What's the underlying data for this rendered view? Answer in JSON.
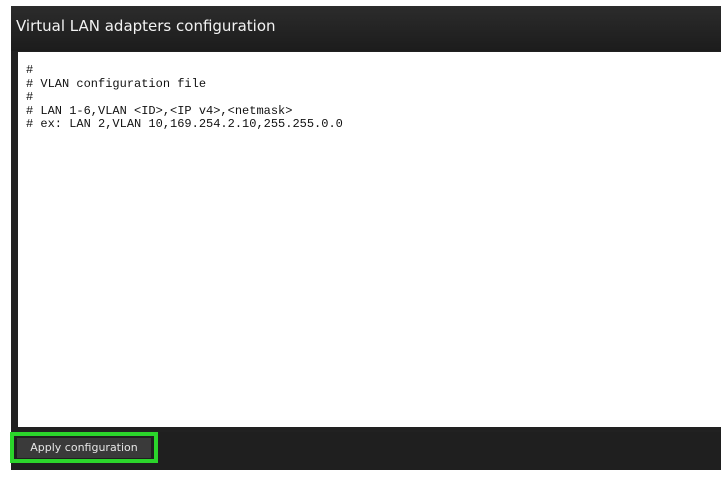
{
  "window": {
    "title": "Virtual LAN adapters configuration"
  },
  "editor": {
    "content": "#\n# VLAN configuration file\n#\n# LAN 1-6,VLAN <ID>,<IP v4>,<netmask>\n# ex: LAN 2,VLAN 10,169.254.2.10,255.255.0.0"
  },
  "footer": {
    "apply_label": "Apply configuration"
  },
  "colors": {
    "panel_background": "#212121",
    "highlight": "#2bd52b"
  }
}
